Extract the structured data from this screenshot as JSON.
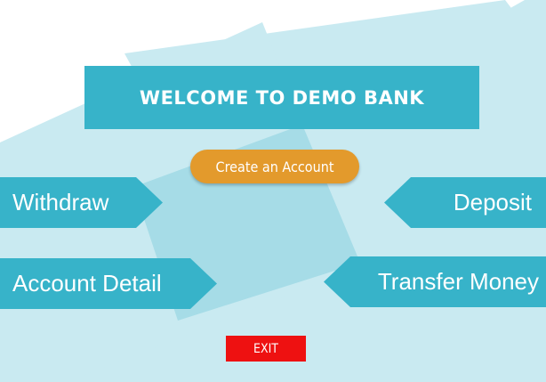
{
  "banner": {
    "title": "WELCOME TO DEMO BANK"
  },
  "actions": {
    "create_account": "Create an Account",
    "withdraw": "Withdraw",
    "deposit": "Deposit",
    "account_detail": "Account Detail",
    "transfer_money": "Transfer Money",
    "exit": "EXIT"
  },
  "colors": {
    "banner_bg": "#37b3c9",
    "arrow_bg": "#37b3c9",
    "create_button": "#e39a2c",
    "exit_button": "#ee1111",
    "shape_light": "#c9eaf1",
    "shape_mid": "#a6dce7"
  }
}
